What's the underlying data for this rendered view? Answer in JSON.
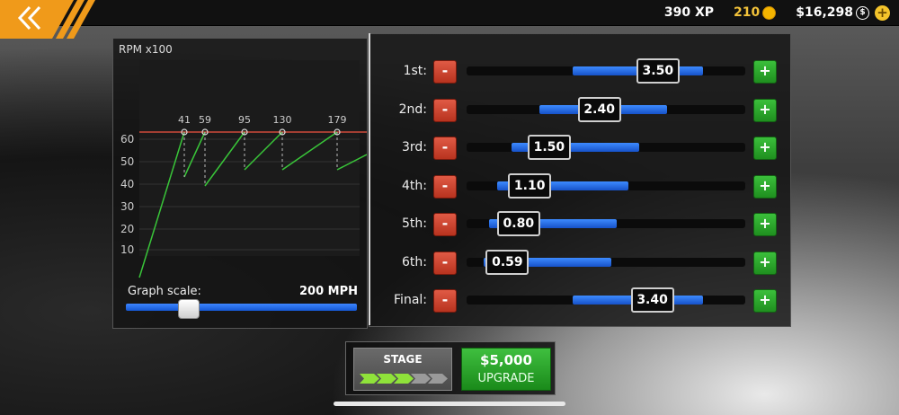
{
  "header": {
    "xp": "390 XP",
    "coins": "210",
    "cash": "$16,298"
  },
  "graph": {
    "title": "RPM x100",
    "y_ticks": [
      "60",
      "50",
      "40",
      "30",
      "20",
      "10"
    ],
    "shift_points": [
      "41",
      "59",
      "95",
      "130",
      "179"
    ],
    "scale_label": "Graph scale:",
    "scale_value": "200 MPH",
    "scale_fraction": 0.25
  },
  "gears": [
    {
      "label": "1st:",
      "value": "3.50",
      "fill": [
        0.38,
        0.85
      ],
      "pos": 0.68
    },
    {
      "label": "2nd:",
      "value": "2.40",
      "fill": [
        0.26,
        0.72
      ],
      "pos": 0.47
    },
    {
      "label": "3rd:",
      "value": "1.50",
      "fill": [
        0.16,
        0.62
      ],
      "pos": 0.29
    },
    {
      "label": "4th:",
      "value": "1.10",
      "fill": [
        0.11,
        0.58
      ],
      "pos": 0.22
    },
    {
      "label": "5th:",
      "value": "0.80",
      "fill": [
        0.08,
        0.54
      ],
      "pos": 0.18
    },
    {
      "label": "6th:",
      "value": "0.59",
      "fill": [
        0.06,
        0.52
      ],
      "pos": 0.14
    },
    {
      "label": "Final:",
      "value": "3.40",
      "fill": [
        0.38,
        0.85
      ],
      "pos": 0.66
    }
  ],
  "buttons": {
    "minus": "-",
    "plus": "+"
  },
  "stage": {
    "label": "STAGE",
    "filled": 3,
    "total": 5
  },
  "upgrade": {
    "price": "$5,000",
    "label": "UPGRADE"
  }
}
